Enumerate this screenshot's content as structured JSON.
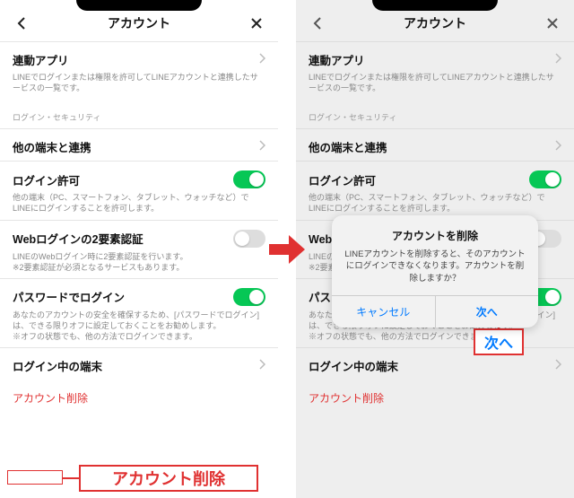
{
  "header": {
    "title": "アカウント"
  },
  "linked_apps": {
    "title": "連動アプリ",
    "desc": "LINEでログインまたは権限を許可してLINEアカウントと連携したサービスの一覧です。"
  },
  "group_login": "ログイン・セキュリティ",
  "other_devices": {
    "title": "他の端末と連携"
  },
  "login_allow": {
    "title": "ログイン許可",
    "desc": "他の端末（PC、スマートフォン、タブレット、ウォッチなど）でLINEにログインすることを許可します。"
  },
  "web_2fa": {
    "title": "Webログインの2要素認証",
    "desc": "LINEのWebログイン時に2要素認証を行います。\n※2要素認証が必須となるサービスもあります。"
  },
  "pw_login": {
    "title": "パスワードでログイン",
    "desc": "あなたのアカウントの安全を確保するため、[パスワードでログイン]は、できる限りオフに設定しておくことをお勧めします。\n※オフの状態でも、他の方法でログインできます。"
  },
  "logged_in": {
    "title": "ログイン中の端末"
  },
  "delete": "アカウント削除",
  "dialog": {
    "title": "アカウントを削除",
    "msg": "LINEアカウントを削除すると、そのアカウントにログインできなくなります。アカウントを削除しますか？",
    "cancel": "キャンセル",
    "next": "次へ"
  },
  "callout": {
    "delete": "アカウント削除",
    "next": "次へ"
  },
  "web_2fa_short": {
    "title": "Webログ",
    "desc": "LINEのWeb\n※2要素認"
  }
}
